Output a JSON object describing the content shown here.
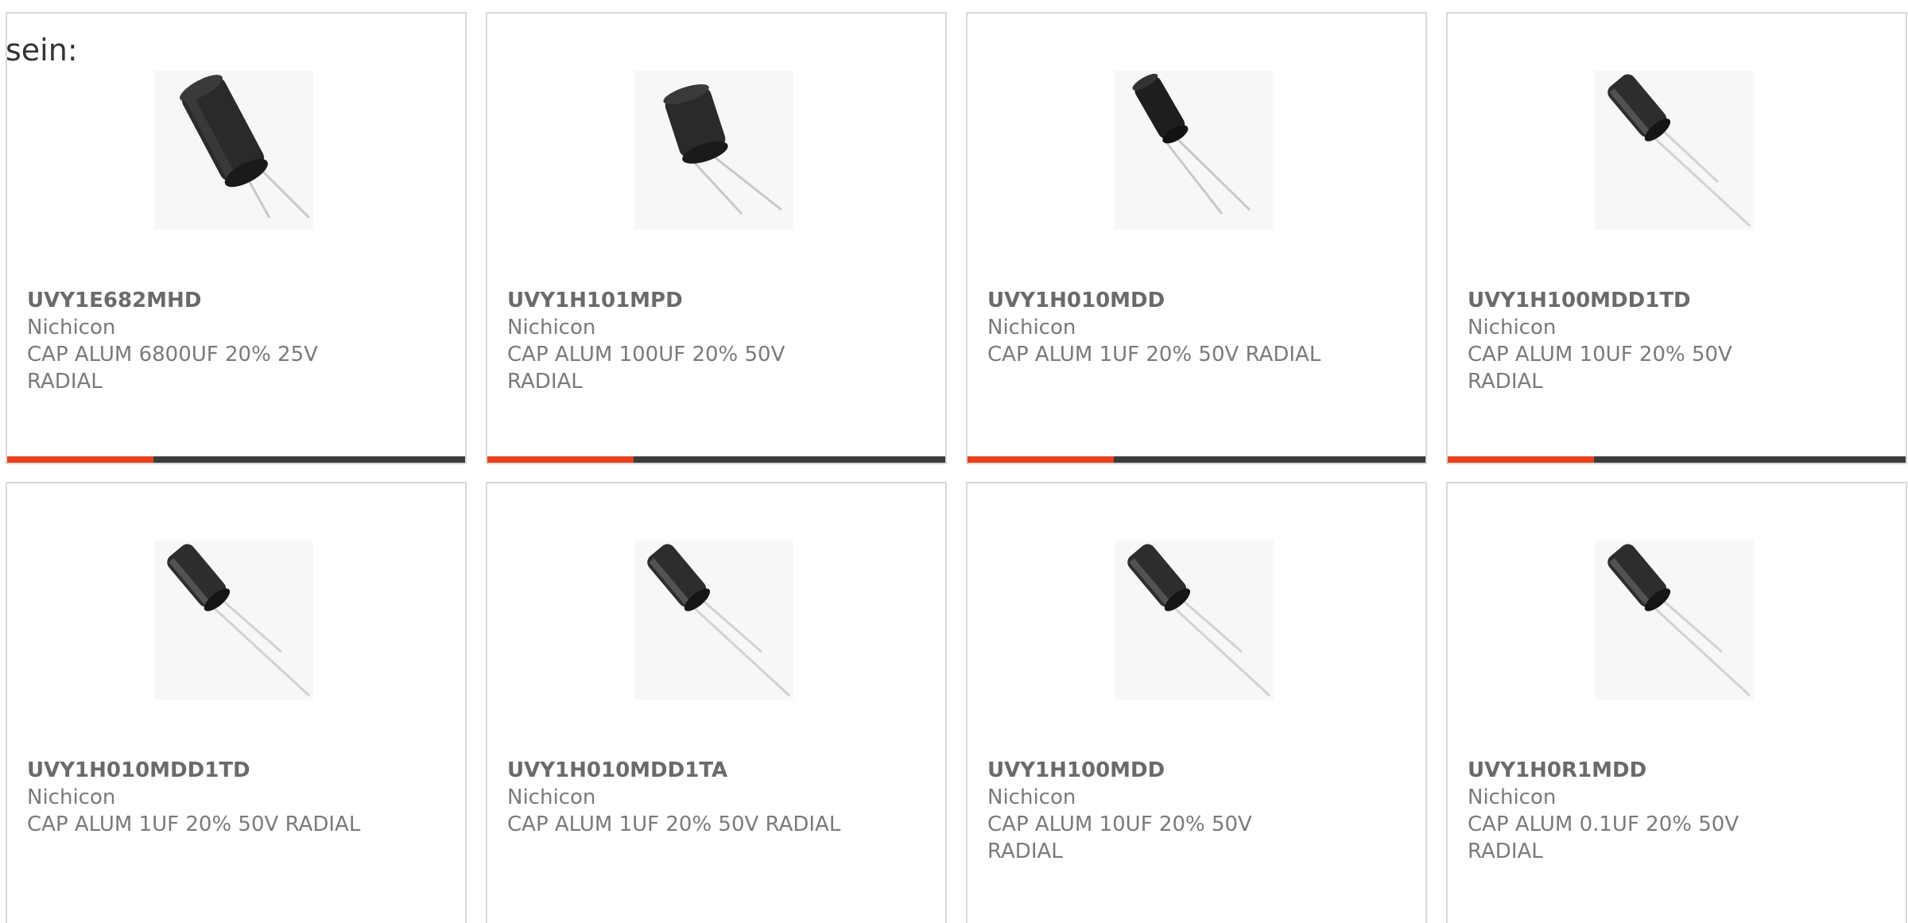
{
  "intro_text": "sein:",
  "accent_color": "#e8421c",
  "bar_color": "#3c3c3c",
  "products": [
    {
      "part_number": "UVY1E682MHD",
      "manufacturer": "Nichicon",
      "description": "CAP ALUM 6800UF 20% 25V RADIAL",
      "image_icon": "capacitor-large-icon",
      "show_bar": true
    },
    {
      "part_number": "UVY1H101MPD",
      "manufacturer": "Nichicon",
      "description": "CAP ALUM 100UF 20% 50V RADIAL",
      "image_icon": "capacitor-short-icon",
      "show_bar": true
    },
    {
      "part_number": "UVY1H010MDD",
      "manufacturer": "Nichicon",
      "description": "CAP ALUM 1UF 20% 50V RADIAL",
      "image_icon": "capacitor-small-icon",
      "show_bar": true
    },
    {
      "part_number": "UVY1H100MDD1TD",
      "manufacturer": "Nichicon",
      "description": "CAP ALUM 10UF 20% 50V RADIAL",
      "image_icon": "capacitor-slim-icon",
      "show_bar": true
    },
    {
      "part_number": "UVY1H010MDD1TD",
      "manufacturer": "Nichicon",
      "description": "CAP ALUM 1UF 20% 50V RADIAL",
      "image_icon": "capacitor-slim-icon",
      "show_bar": false
    },
    {
      "part_number": "UVY1H010MDD1TA",
      "manufacturer": "Nichicon",
      "description": "CAP ALUM 1UF 20% 50V RADIAL",
      "image_icon": "capacitor-slim-icon",
      "show_bar": false
    },
    {
      "part_number": "UVY1H100MDD",
      "manufacturer": "Nichicon",
      "description": "CAP ALUM 10UF 20% 50V RADIAL",
      "image_icon": "capacitor-slim-icon",
      "show_bar": false
    },
    {
      "part_number": "UVY1H0R1MDD",
      "manufacturer": "Nichicon",
      "description": "CAP ALUM 0.1UF 20% 50V RADIAL",
      "image_icon": "capacitor-slim-icon",
      "show_bar": false
    }
  ]
}
